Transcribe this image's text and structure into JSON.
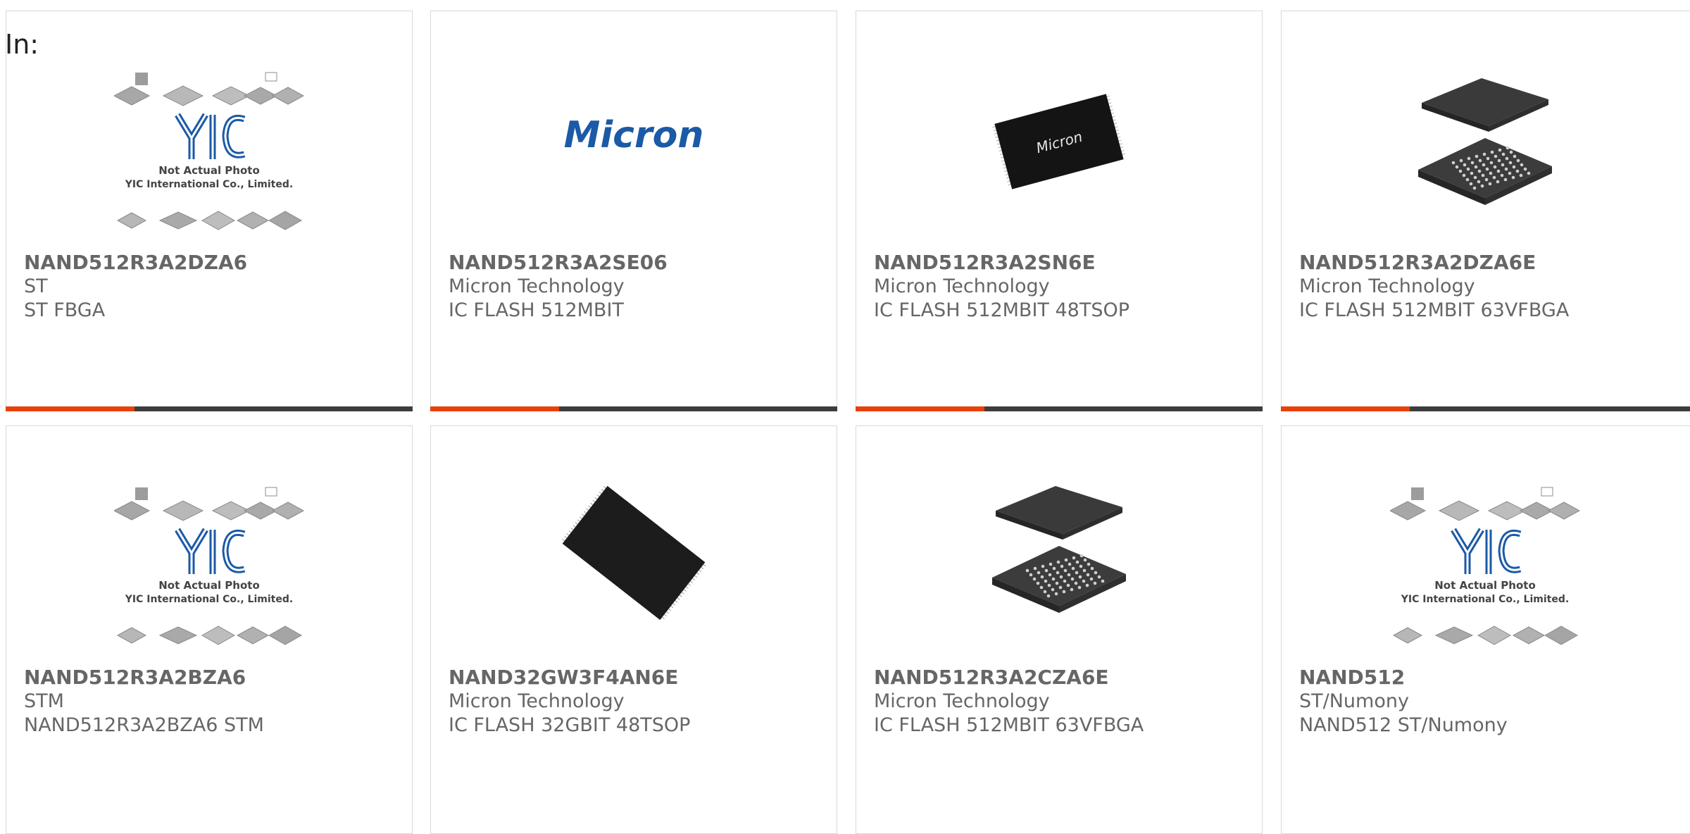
{
  "page": {
    "filter_label": "In:"
  },
  "colors": {
    "accent": "#e8400c",
    "bar": "#3d3d3d",
    "text": "#666666",
    "micron_blue": "#1a5aa6"
  },
  "image_text": {
    "not_actual_photo": "Not Actual Photo",
    "company": "YIC International Co., Limited.",
    "yic_logo": "YIC",
    "micron_logo": "Micron"
  },
  "products": [
    {
      "part_number": "NAND512R3A2DZA6",
      "manufacturer": "ST",
      "description": "ST FBGA",
      "image": "yic-placeholder"
    },
    {
      "part_number": "NAND512R3A2SE06",
      "manufacturer": "Micron Technology",
      "description": "IC FLASH 512MBIT",
      "image": "micron-logo"
    },
    {
      "part_number": "NAND512R3A2SN6E",
      "manufacturer": "Micron Technology",
      "description": "IC FLASH 512MBIT 48TSOP",
      "image": "tsop-chip"
    },
    {
      "part_number": "NAND512R3A2DZA6E",
      "manufacturer": "Micron Technology",
      "description": "IC FLASH 512MBIT 63VFBGA",
      "image": "bga-chip"
    },
    {
      "part_number": "NAND512R3A2BZA6",
      "manufacturer": "STM",
      "description": "NAND512R3A2BZA6 STM",
      "image": "yic-placeholder"
    },
    {
      "part_number": "NAND32GW3F4AN6E",
      "manufacturer": "Micron Technology",
      "description": "IC FLASH 32GBIT 48TSOP",
      "image": "tsop-chip-blank"
    },
    {
      "part_number": "NAND512R3A2CZA6E",
      "manufacturer": "Micron Technology",
      "description": "IC FLASH 512MBIT 63VFBGA",
      "image": "bga-chip"
    },
    {
      "part_number": "NAND512",
      "manufacturer": "ST/Numony",
      "description": "NAND512 ST/Numony",
      "image": "yic-placeholder"
    }
  ]
}
